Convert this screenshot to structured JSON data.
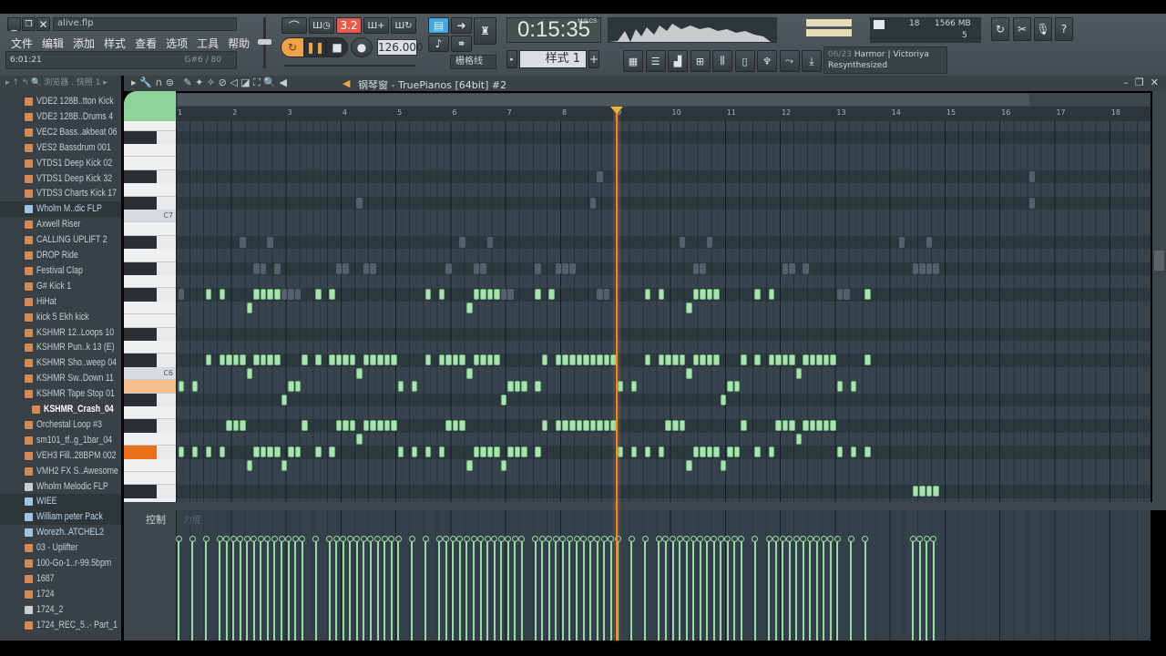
{
  "window": {
    "title": "alive.flp",
    "menu": [
      "文件",
      "编辑",
      "添加",
      "样式",
      "查看",
      "选项",
      "工具",
      "帮助"
    ],
    "hint_time": "6:01:21",
    "hint_note": "G#6 / 80"
  },
  "transport": {
    "tempo": "126.000",
    "time": "0:15:35",
    "time_unit": "M:S:CS",
    "pattern": "样式 1",
    "snap": "栅格线",
    "metronome_label": "3.2"
  },
  "monitor": {
    "cpu": "18",
    "memory": "1566 MB",
    "polyphony": "5"
  },
  "hint_panel": {
    "line1_dim": "06/23",
    "line1": "Harmor | Victoriya",
    "line2": "Resynthesized"
  },
  "browser": {
    "title": "浏览器 . 快照 1",
    "items": [
      {
        "label": "VDE2 128B..tton Kick",
        "type": "sample"
      },
      {
        "label": "VDE2 128B..Drums 4",
        "type": "sample"
      },
      {
        "label": "VEC2 Bass..akbeat 06",
        "type": "sample"
      },
      {
        "label": "VES2 Bassdrum 001",
        "type": "sample"
      },
      {
        "label": "VTDS1 Deep Kick 02",
        "type": "sample"
      },
      {
        "label": "VTDS1 Deep Kick 32",
        "type": "sample"
      },
      {
        "label": "VTDS3 Charts Kick 17",
        "type": "sample"
      },
      {
        "label": "Wholm M..dic FLP",
        "type": "folder",
        "selected": true
      },
      {
        "label": "Axwell Riser",
        "type": "sample"
      },
      {
        "label": "CALLING UPLIFT 2",
        "type": "sample"
      },
      {
        "label": "DROP Ride",
        "type": "sample"
      },
      {
        "label": "Festival Clap",
        "type": "sample"
      },
      {
        "label": "G# Kick 1",
        "type": "sample"
      },
      {
        "label": "HiHat",
        "type": "sample"
      },
      {
        "label": "kick 5 Ekh kick",
        "type": "sample"
      },
      {
        "label": "KSHMR 12..Loops 10",
        "type": "sample"
      },
      {
        "label": "KSHMR Pun..k 13 (E)",
        "type": "sample"
      },
      {
        "label": "KSHMR Sho..weep 04",
        "type": "sample"
      },
      {
        "label": "KSHMR Sw..Down 11",
        "type": "sample"
      },
      {
        "label": "KSHMR Tape Stop 01",
        "type": "sample"
      },
      {
        "label": "KSHMR_Crash_04",
        "type": "sample",
        "indent": true
      },
      {
        "label": "Orchestal Loop #3",
        "type": "sample"
      },
      {
        "label": "sm101_tf..g_1bar_04",
        "type": "sample"
      },
      {
        "label": "VEH3 Fill..28BPM 002",
        "type": "sample"
      },
      {
        "label": "VMH2 FX S..Awesome",
        "type": "sample"
      },
      {
        "label": "Wholm Melodic FLP",
        "type": "doc"
      },
      {
        "label": "WIEE",
        "type": "folder",
        "selected": true
      },
      {
        "label": "William peter Pack",
        "type": "folder",
        "selected": true
      },
      {
        "label": "Worezh..ATCHEL2",
        "type": "folder"
      },
      {
        "label": "03 - Uplifter",
        "type": "sample"
      },
      {
        "label": "100-Go-1..r-99.5bpm",
        "type": "sample"
      },
      {
        "label": "1687",
        "type": "sample"
      },
      {
        "label": "1724",
        "type": "mp3"
      },
      {
        "label": "1724_2",
        "type": "doc"
      },
      {
        "label": "1724_REC_5..- Part_1",
        "type": "sample"
      }
    ]
  },
  "piano_roll": {
    "title": "钢琴窗 - TruePianos [64bit] #2",
    "bars": [
      "1",
      "2",
      "3",
      "4",
      "5",
      "6",
      "7",
      "8",
      "9",
      "10",
      "11",
      "12",
      "13",
      "14",
      "15",
      "16",
      "17",
      "18"
    ],
    "key_labels": {
      "C7": "C7",
      "C6": "C6"
    },
    "pressed_keys": [
      "B5",
      "F#5"
    ],
    "playhead_bar": 9,
    "grid": "1/8 bar steps",
    "pattern_repeat_from_step": 64,
    "pattern_repeat_until_step": 100,
    "notes": {
      "F#6": [
        4,
        6,
        11,
        12,
        13,
        14,
        20,
        22,
        36,
        38,
        43,
        44,
        45,
        46,
        52,
        54
      ],
      "F6": [
        10,
        42
      ],
      "C#6": [
        4,
        6,
        7,
        8,
        9,
        11,
        12,
        13,
        14,
        18,
        20,
        22,
        23,
        24,
        25,
        27,
        28,
        29,
        30,
        31,
        36,
        38,
        39,
        40,
        41,
        43,
        44,
        45,
        46,
        53,
        55,
        56,
        57,
        58,
        59,
        60,
        61,
        62,
        63
      ],
      "C6": [
        10,
        26,
        42
      ],
      "B5": [
        0,
        2,
        16,
        17,
        32,
        34,
        48,
        49,
        50,
        52
      ],
      "A#5": [
        15,
        47
      ],
      "G#5": [
        7,
        8,
        9,
        18,
        23,
        24,
        25,
        27,
        28,
        29,
        30,
        31,
        39,
        40,
        41,
        53,
        55,
        56,
        57,
        58,
        59,
        60,
        61,
        62,
        63
      ],
      "G5": [
        26
      ],
      "F#5": [
        0,
        2,
        4,
        6,
        11,
        12,
        13,
        14,
        16,
        17,
        20,
        22,
        32,
        34,
        36,
        38,
        43,
        44,
        45,
        46,
        48,
        49,
        50,
        52
      ],
      "F5": [
        10,
        15,
        42,
        47
      ]
    },
    "extra_notes": {
      "D#5": [
        107,
        108,
        109,
        110
      ]
    },
    "ghost_notes": {
      "D#7": [
        61,
        124
      ],
      "C#7": [
        26,
        60,
        124
      ],
      "A#6": [
        9,
        13,
        41,
        45,
        73,
        77,
        105,
        109
      ],
      "G#6": [
        11,
        12,
        14,
        23,
        24,
        27,
        28,
        39,
        43,
        44,
        52,
        55,
        56,
        57,
        75,
        76,
        88,
        89,
        91,
        107,
        108,
        109,
        110
      ],
      "F#6": [
        0,
        15,
        16,
        17,
        47,
        48,
        61,
        62,
        96,
        97
      ]
    },
    "control_label": "控制",
    "control_param": "力度",
    "velocity": 0.78
  },
  "colors": {
    "note": "#a8e3b0",
    "playhead": "#e8892f",
    "accent_green": "#8fd39a",
    "pressed_key": "#f6c08c",
    "pressed_black_key": "#e8701a",
    "metronome": "#e85a4f"
  }
}
